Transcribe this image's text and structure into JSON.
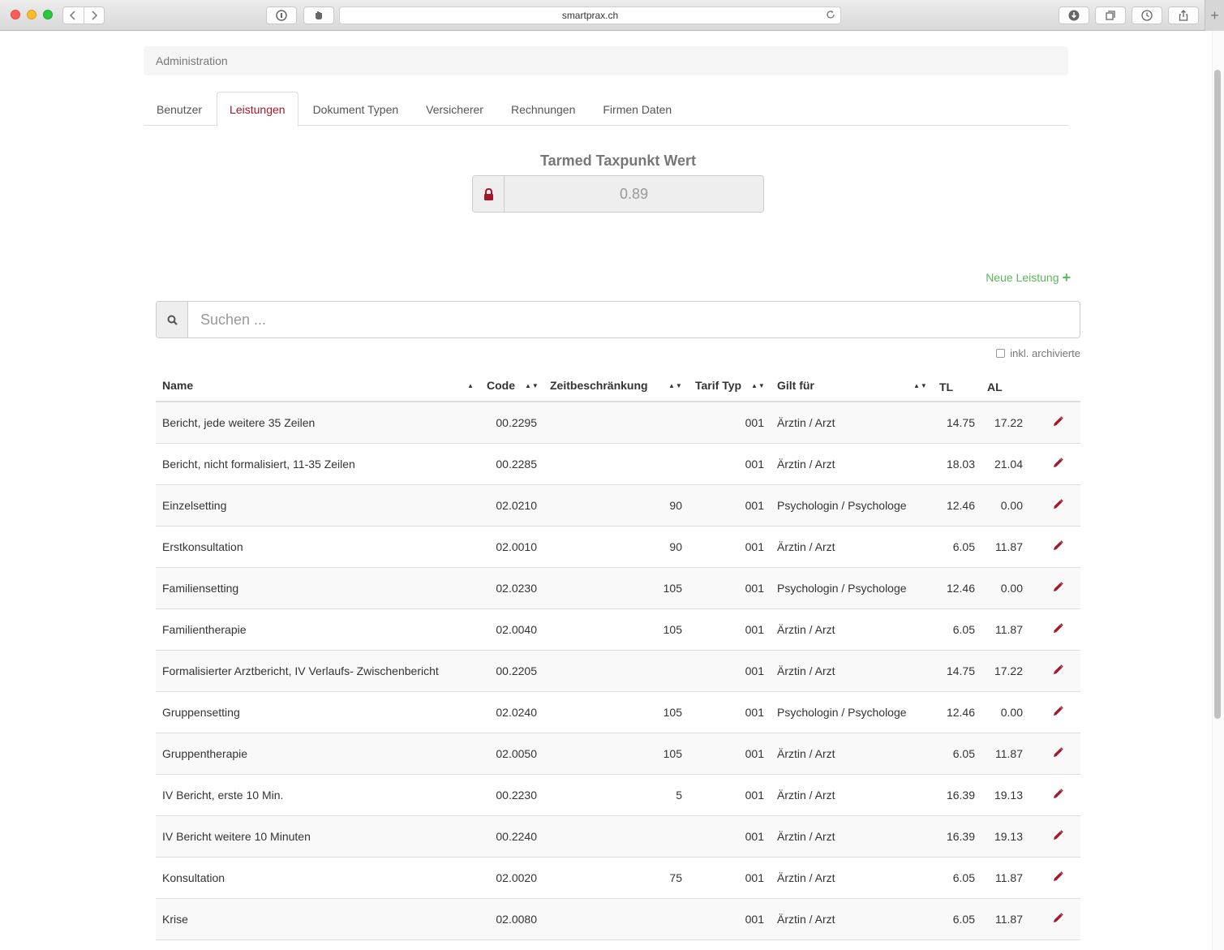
{
  "browser": {
    "url": "smartprax.ch"
  },
  "breadcrumb": "Administration",
  "tabs": [
    {
      "label": "Benutzer",
      "active": false
    },
    {
      "label": "Leistungen",
      "active": true
    },
    {
      "label": "Dokument Typen",
      "active": false
    },
    {
      "label": "Versicherer",
      "active": false
    },
    {
      "label": "Rechnungen",
      "active": false
    },
    {
      "label": "Firmen Daten",
      "active": false
    }
  ],
  "taxpunkt": {
    "title": "Tarmed Taxpunkt Wert",
    "value": "0.89",
    "icon": "lock-icon"
  },
  "new_service_label": "Neue Leistung",
  "search": {
    "placeholder": "Suchen ...",
    "value": ""
  },
  "archive_label": "inkl. archivierte",
  "archive_checked": false,
  "table": {
    "headers": {
      "name": "Name",
      "code": "Code",
      "zeit": "Zeitbeschränkung",
      "tarif": "Tarif Typ",
      "gilt": "Gilt für",
      "tl": "TL",
      "al": "AL"
    },
    "rows": [
      {
        "name": "Bericht, jede weitere 35 Zeilen",
        "code": "00.2295",
        "zeit": "",
        "tarif": "001",
        "gilt": "Ärztin / Arzt",
        "tl": "14.75",
        "al": "17.22"
      },
      {
        "name": "Bericht, nicht formalisiert, 11-35 Zeilen",
        "code": "00.2285",
        "zeit": "",
        "tarif": "001",
        "gilt": "Ärztin / Arzt",
        "tl": "18.03",
        "al": "21.04"
      },
      {
        "name": "Einzelsetting",
        "code": "02.0210",
        "zeit": "90",
        "tarif": "001",
        "gilt": "Psychologin / Psychologe",
        "tl": "12.46",
        "al": "0.00"
      },
      {
        "name": "Erstkonsultation",
        "code": "02.0010",
        "zeit": "90",
        "tarif": "001",
        "gilt": "Ärztin / Arzt",
        "tl": "6.05",
        "al": "11.87"
      },
      {
        "name": "Familiensetting",
        "code": "02.0230",
        "zeit": "105",
        "tarif": "001",
        "gilt": "Psychologin / Psychologe",
        "tl": "12.46",
        "al": "0.00"
      },
      {
        "name": "Familientherapie",
        "code": "02.0040",
        "zeit": "105",
        "tarif": "001",
        "gilt": "Ärztin / Arzt",
        "tl": "6.05",
        "al": "11.87"
      },
      {
        "name": "Formalisierter Arztbericht, IV Verlaufs- Zwischenbericht",
        "code": "00.2205",
        "zeit": "",
        "tarif": "001",
        "gilt": "Ärztin / Arzt",
        "tl": "14.75",
        "al": "17.22"
      },
      {
        "name": "Gruppensetting",
        "code": "02.0240",
        "zeit": "105",
        "tarif": "001",
        "gilt": "Psychologin / Psychologe",
        "tl": "12.46",
        "al": "0.00"
      },
      {
        "name": "Gruppentherapie",
        "code": "02.0050",
        "zeit": "105",
        "tarif": "001",
        "gilt": "Ärztin / Arzt",
        "tl": "6.05",
        "al": "11.87"
      },
      {
        "name": "IV Bericht, erste 10 Min.",
        "code": "00.2230",
        "zeit": "5",
        "tarif": "001",
        "gilt": "Ärztin / Arzt",
        "tl": "16.39",
        "al": "19.13"
      },
      {
        "name": "IV Bericht weitere 10 Minuten",
        "code": "00.2240",
        "zeit": "",
        "tarif": "001",
        "gilt": "Ärztin / Arzt",
        "tl": "16.39",
        "al": "19.13"
      },
      {
        "name": "Konsultation",
        "code": "02.0020",
        "zeit": "75",
        "tarif": "001",
        "gilt": "Ärztin / Arzt",
        "tl": "6.05",
        "al": "11.87"
      },
      {
        "name": "Krise",
        "code": "02.0080",
        "zeit": "",
        "tarif": "001",
        "gilt": "Ärztin / Arzt",
        "tl": "6.05",
        "al": "11.87"
      }
    ]
  },
  "colors": {
    "accent": "#a01a2a",
    "success": "#5cb85c"
  }
}
